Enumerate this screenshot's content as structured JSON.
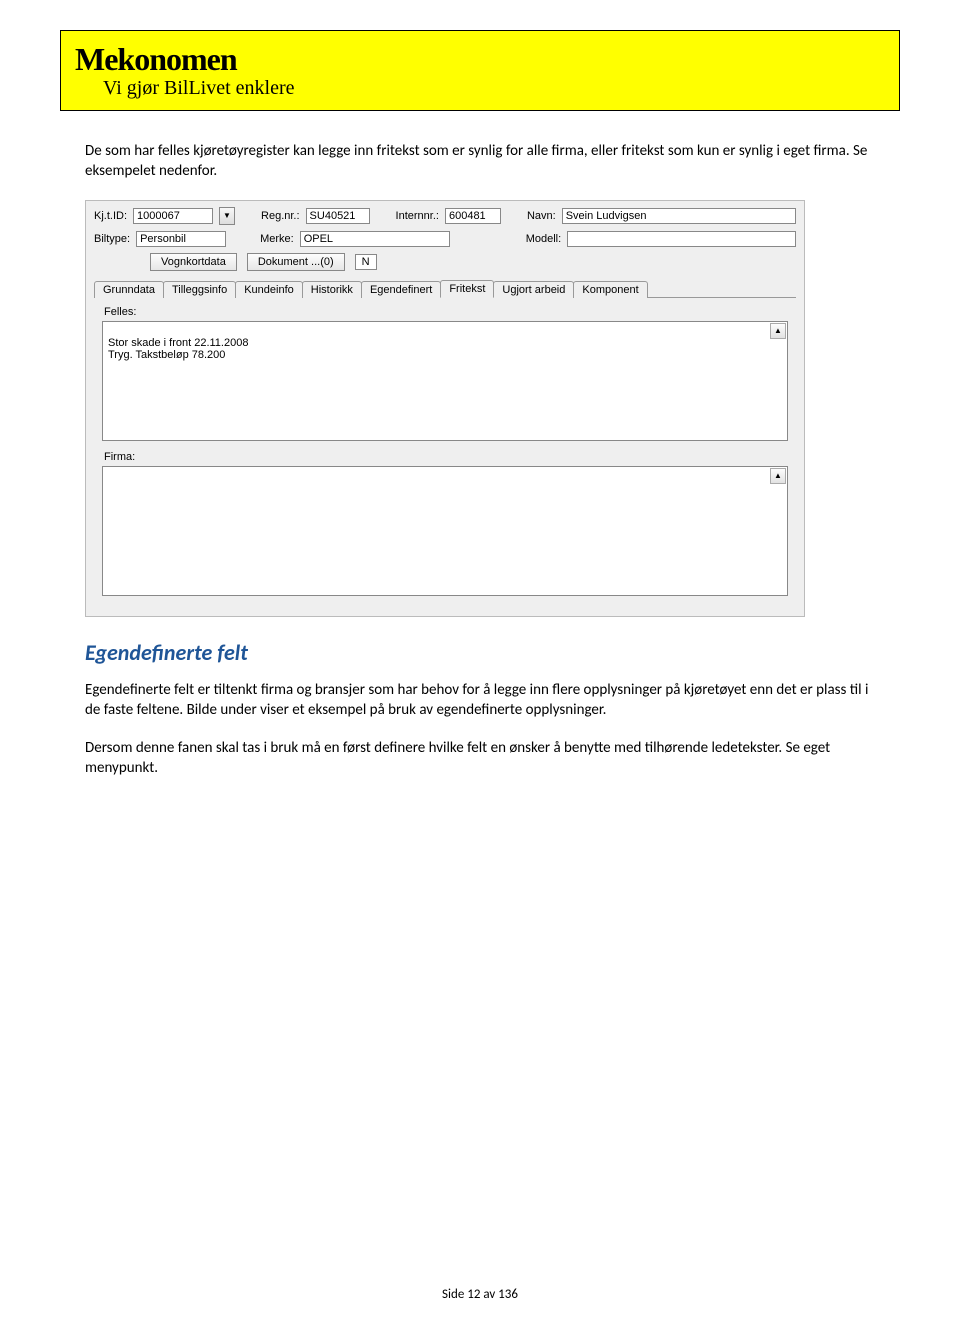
{
  "header": {
    "logo": "Mekonomen",
    "tagline": "Vi gjør BilLivet enklere"
  },
  "paragraphs": {
    "p1": "De som har felles kjøretøyregister kan legge inn fritekst som er synlig for alle firma, eller fritekst som kun er synlig i eget firma. Se eksempelet nedenfor.",
    "heading": "Egendefinerte felt",
    "p2": "Egendefinerte felt er tiltenkt firma og bransjer som har behov for å legge inn flere opplysninger på kjøretøyet enn det er plass til i de faste feltene. Bilde under viser et eksempel på bruk av egendefinerte opplysninger.",
    "p3": "Dersom denne fanen skal tas i bruk må en først definere hvilke felt en ønsker å benytte med tilhørende ledetekster. Se eget menypunkt."
  },
  "app": {
    "labels": {
      "kjtid": "Kj.t.ID:",
      "regnr": "Reg.nr.:",
      "internnr": "Internnr.:",
      "navn": "Navn:",
      "biltype": "Biltype:",
      "merke": "Merke:",
      "modell": "Modell:",
      "felles": "Felles:",
      "firma": "Firma:"
    },
    "values": {
      "kjtid": "1000067",
      "regnr": "SU40521",
      "internnr": "600481",
      "navn": "Svein Ludvigsen",
      "biltype": "Personbil",
      "merke": "OPEL",
      "modell": ""
    },
    "buttons": {
      "vognkortdata": "Vognkortdata",
      "dokument": "Dokument ...(0)",
      "n": "N"
    },
    "tabs": [
      "Grunndata",
      "Tilleggsinfo",
      "Kundeinfo",
      "Historikk",
      "Egendefinert",
      "Fritekst",
      "Ugjort arbeid",
      "Komponent"
    ],
    "active_tab": 5,
    "felles_text": "Stor skade i front 22.11.2008\nTryg. Takstbeløp 78.200",
    "firma_text": ""
  },
  "footer": "Side 12 av 136"
}
